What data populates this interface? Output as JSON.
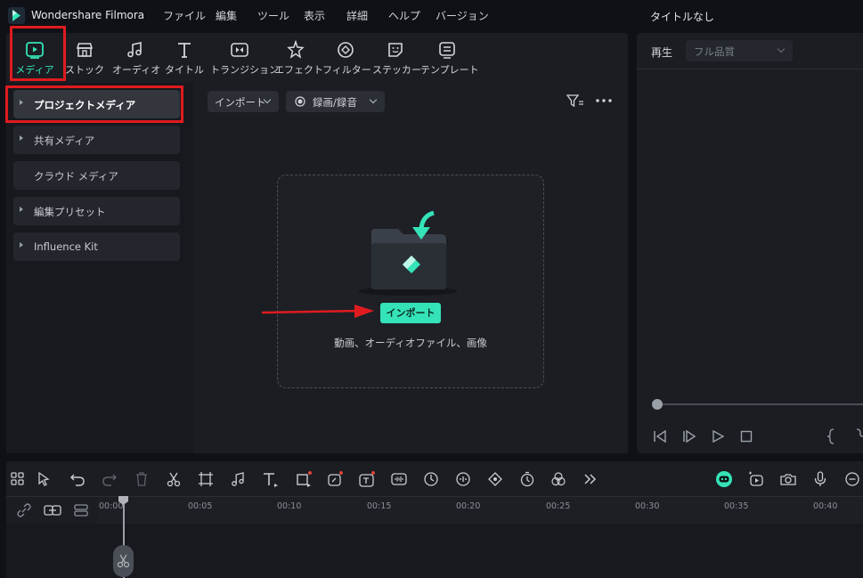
{
  "app": {
    "name": "Wondershare Filmora",
    "project_title": "タイトルなし"
  },
  "menu": [
    "ファイル",
    "編集",
    "ツール",
    "表示",
    "詳細",
    "ヘルプ",
    "バージョン"
  ],
  "toolbar": [
    {
      "label": "メディア",
      "icon": "media-icon",
      "active": true
    },
    {
      "label": "ストック",
      "icon": "stock-icon"
    },
    {
      "label": "オーディオ",
      "icon": "audio-icon"
    },
    {
      "label": "タイトル",
      "icon": "title-icon"
    },
    {
      "label": "トランジション",
      "icon": "transition-icon"
    },
    {
      "label": "エフェクト",
      "icon": "effect-icon"
    },
    {
      "label": "フィルター",
      "icon": "filter-icon"
    },
    {
      "label": "ステッカー",
      "icon": "sticker-icon"
    },
    {
      "label": "テンプレート",
      "icon": "template-icon"
    }
  ],
  "sidebar": {
    "items": [
      {
        "label": "プロジェクトメディア",
        "active": true,
        "expandable": true
      },
      {
        "label": "共有メディア",
        "expandable": true
      },
      {
        "label": "クラウド メディア",
        "expandable": false
      },
      {
        "label": "編集プリセット",
        "expandable": true
      },
      {
        "label": "Influence Kit",
        "expandable": true
      }
    ]
  },
  "content": {
    "import_dropdown": "インポート",
    "record_dropdown": "録画/録音",
    "import_button": "インポート",
    "drop_hint": "動画、オーディオファイル、画像"
  },
  "preview": {
    "play_label": "再生",
    "quality": "フル品質"
  },
  "timeline": {
    "ticks": [
      "00:00",
      "00:05",
      "00:10",
      "00:15",
      "00:20",
      "00:25",
      "00:30",
      "00:35",
      "00:40"
    ]
  },
  "colors": {
    "accent": "#35e3b8",
    "highlight": "#e01b1f"
  }
}
